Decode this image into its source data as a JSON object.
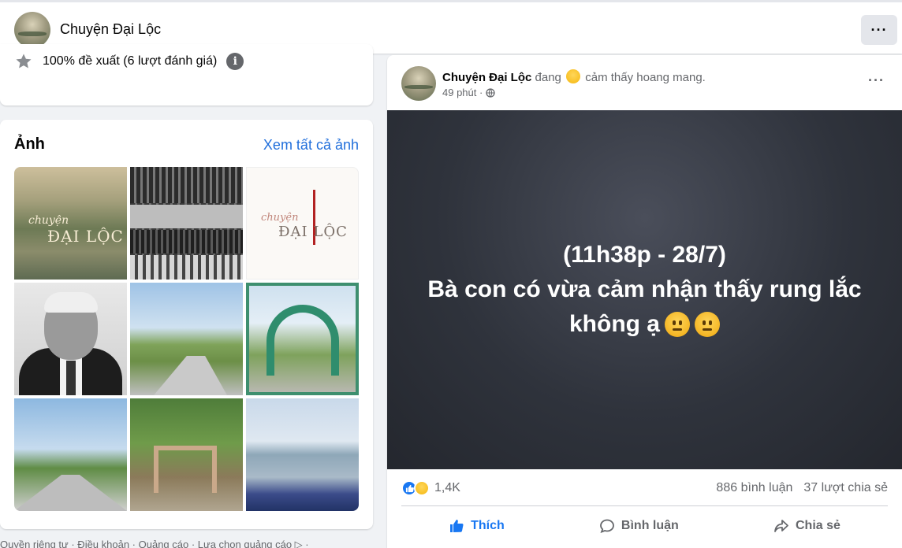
{
  "header": {
    "page_name": "Chuyện Đại Lộc",
    "more_label": "···"
  },
  "rating": {
    "text": "100% đề xuất (6 lượt đánh giá)",
    "info_glyph": "i",
    "icons": [
      "star-icon",
      "info-icon"
    ]
  },
  "photos": {
    "title": "Ảnh",
    "see_all": "Xem tất cả ảnh",
    "thumbs": [
      {
        "name": "photo-1-logo-landscape",
        "caption_a": "chuyện",
        "caption_b": "ĐẠI LỘC"
      },
      {
        "name": "photo-2-meeting-collage"
      },
      {
        "name": "photo-3-logo-white",
        "caption_a": "chuyện",
        "caption_b": "ĐẠI LỘC"
      },
      {
        "name": "photo-4-portrait"
      },
      {
        "name": "photo-5-rural-road"
      },
      {
        "name": "photo-6-village-gate"
      },
      {
        "name": "photo-7-road-flags"
      },
      {
        "name": "photo-8-tree-gate"
      },
      {
        "name": "photo-9-river-crowd"
      }
    ]
  },
  "post": {
    "author": "Chuyện Đại Lộc",
    "feeling_prefix": "đang",
    "feeling_text": "cảm thấy hoang mang.",
    "time": "49 phút ·",
    "more_label": "···",
    "image_text": {
      "line1": "(11h38p - 28/7)",
      "line2": "Bà con có vừa cảm nhận thấy rung lắc",
      "line3": "không ạ"
    },
    "reaction_count": "1,4K",
    "comments": "886 bình luận",
    "shares": "37 lượt chia sẻ",
    "actions": {
      "like": "Thích",
      "comment": "Bình luận",
      "share": "Chia sẻ"
    },
    "colors": {
      "like_blue": "#1877f2",
      "link_blue": "#216fdb"
    }
  },
  "footer": {
    "text": "Quyền riêng tư · Điều khoản · Quảng cáo · Lựa chọn quảng cáo ▷ ·"
  }
}
